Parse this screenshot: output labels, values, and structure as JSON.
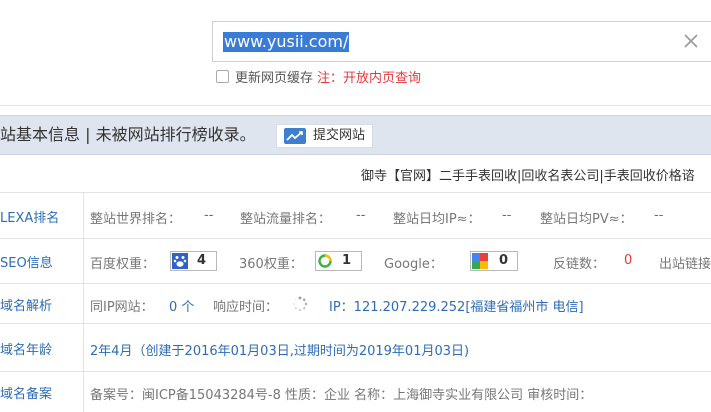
{
  "search": {
    "value": "www.yusii.com/"
  },
  "cache": {
    "label": "更新网页缓存",
    "note": "注：开放内页查询"
  },
  "info_header": {
    "title": "站基本信息 | 未被网站排行榜收录。",
    "submit_label": "提交网站"
  },
  "ad": {
    "text": "御寺【官网】二手手表回收|回收名表公司|手表回收价格谘"
  },
  "rows": {
    "alexa": {
      "label": "LEXA排名",
      "world_rank_label": "整站世界排名：",
      "world_rank_value": "--",
      "traffic_rank_label": "整站流量排名：",
      "traffic_rank_value": "--",
      "daily_ip_label": "整站日均IP≈：",
      "daily_ip_value": "--",
      "daily_pv_label": "整站日均PV≈：",
      "daily_pv_value": "--"
    },
    "seo": {
      "label": "SEO信息",
      "baidu_label": "百度权重：",
      "baidu_value": "4",
      "w360_label": "360权重：",
      "w360_value": "1",
      "google_label": "Google：",
      "google_value": "0",
      "backlinks_label": "反链数：",
      "backlinks_value": "0",
      "outlinks_label": "出站链接"
    },
    "dns": {
      "label": "域名解析",
      "same_ip_label": "同IP网站：",
      "same_ip_value": "0 个",
      "response_label": "响应时间：",
      "ip_text": "IP：121.207.229.252[福建省福州市 电信]"
    },
    "age": {
      "label": "域名年龄",
      "text": "2年4月（创建于2016年01月03日,过期时间为2019年01月03日)"
    },
    "icp": {
      "label": "域名备案",
      "text": "备案号：闽ICP备15043284号-8   性质：企业   名称：上海御寺实业有限公司   审核时间："
    }
  },
  "colors": {
    "link_blue": "#2c6db5",
    "alert_red": "#e4393c",
    "header_bg": "#dfe5ee",
    "selection": "#3a7bd5"
  }
}
